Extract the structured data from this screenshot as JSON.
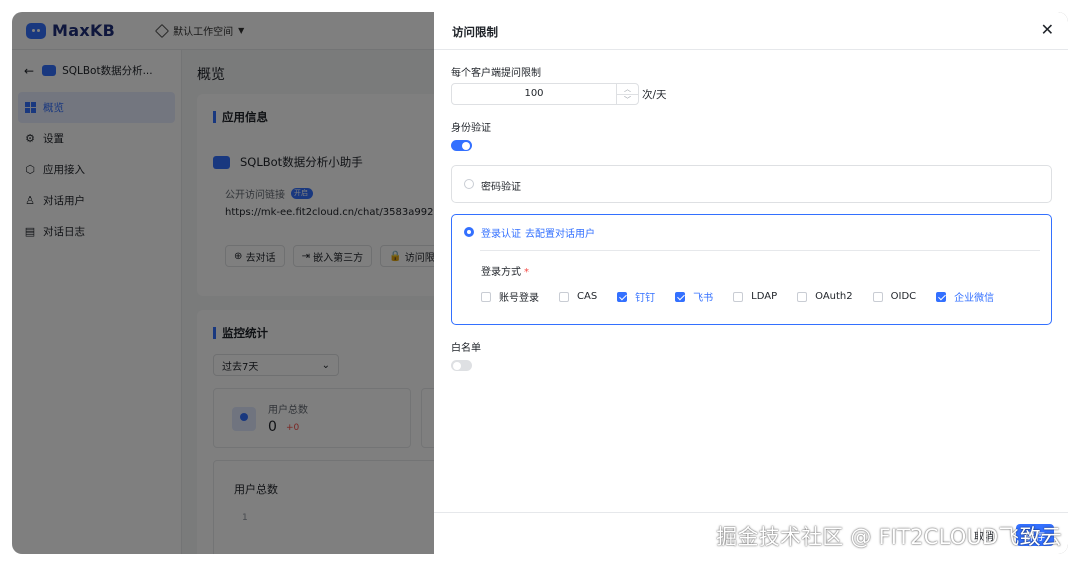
{
  "app": {
    "logo_text": "MaxKB",
    "workspace": "默认工作空间"
  },
  "sidebar": {
    "back_title": "SQLBot数据分析...",
    "items": [
      {
        "label": "概览",
        "icon": "grid-icon",
        "active": true
      },
      {
        "label": "设置",
        "icon": "gear-icon"
      },
      {
        "label": "应用接入",
        "icon": "cube-icon"
      },
      {
        "label": "对话用户",
        "icon": "user-icon"
      },
      {
        "label": "对话日志",
        "icon": "document-icon"
      }
    ]
  },
  "main": {
    "page_title": "概览",
    "info_title": "应用信息",
    "app_name": "SQLBot数据分析小助手",
    "public_link_label": "公开访问链接",
    "toggle_text": "开启",
    "url": "https://mk-ee.fit2cloud.cn/chat/3583a9927c",
    "buttons": [
      "去对话",
      "嵌入第三方",
      "访问限"
    ],
    "monitor_title": "监控统计",
    "range": "过去7天",
    "stat_label": "用户总数",
    "stat_value": "0",
    "stat_delta": "+0",
    "chart_title": "用户总数",
    "chart_y": "1"
  },
  "drawer": {
    "title": "访问限制",
    "limit_label": "每个客户端提问限制",
    "limit_value": "100",
    "limit_unit": "次/天",
    "auth_label": "身份验证",
    "auth_enabled": true,
    "password_option": "密码验证",
    "login_option": "登录认证",
    "login_link": "去配置对话用户",
    "login_methods_label": "登录方式",
    "required_mark": "*",
    "methods": [
      {
        "label": "账号登录",
        "checked": false
      },
      {
        "label": "CAS",
        "checked": false
      },
      {
        "label": "钉钉",
        "checked": true
      },
      {
        "label": "飞书",
        "checked": true
      },
      {
        "label": "LDAP",
        "checked": false
      },
      {
        "label": "OAuth2",
        "checked": false
      },
      {
        "label": "OIDC",
        "checked": false
      },
      {
        "label": "企业微信",
        "checked": true
      }
    ],
    "whitelist_label": "白名单",
    "whitelist_enabled": false,
    "cancel_label": "取消",
    "save_label": "保存"
  },
  "watermark": "掘金技术社区 @ FIT2CLOUD飞致云",
  "colors": {
    "accent": "#3370ff",
    "overlay": "rgba(0,0,0,0.5)",
    "danger": "#f54a45"
  }
}
